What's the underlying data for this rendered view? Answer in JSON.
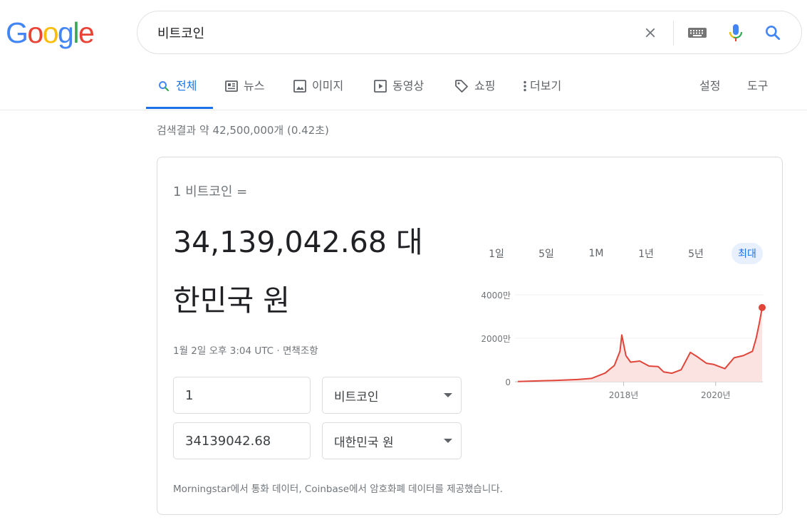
{
  "logo": {
    "letters": [
      "G",
      "o",
      "o",
      "g",
      "l",
      "e"
    ],
    "colors": [
      "#4285f4",
      "#ea4335",
      "#fbbc05",
      "#4285f4",
      "#34a853",
      "#ea4335"
    ]
  },
  "search": {
    "query": "비트코인",
    "icons": [
      "clear-icon",
      "keyboard-icon",
      "mic-icon",
      "search-icon"
    ]
  },
  "tabs": [
    {
      "label": "전체",
      "icon": "search-icon",
      "active": true
    },
    {
      "label": "뉴스",
      "icon": "news-icon"
    },
    {
      "label": "이미지",
      "icon": "image-icon"
    },
    {
      "label": "동영상",
      "icon": "video-icon"
    },
    {
      "label": "쇼핑",
      "icon": "tag-icon"
    },
    {
      "label": "더보기",
      "icon": "more-icon"
    }
  ],
  "tools": {
    "settings": "설정",
    "tools": "도구"
  },
  "result_stats": "검색결과 약 42,500,000개 (0.42초)",
  "converter": {
    "from_label": "1 비트코인 =",
    "value_line1": "34,139,042.68 대",
    "value_line2": "한민국 원",
    "datetime": "1월 2일 오후 3:04 UTC · 면책조항",
    "amount_input": "1",
    "amount_currency": "비트코인",
    "result_input": "34139042.68",
    "result_currency": "대한민국 원",
    "source_note": "Morningstar에서 통화 데이터, Coinbase에서 암호화폐 데이터를 제공했습니다."
  },
  "ranges": [
    "1일",
    "5일",
    "1M",
    "1년",
    "5년",
    "최대"
  ],
  "active_range": "최대",
  "colors": {
    "accent": "#1a73e8",
    "line": "#e0453a",
    "fill": "#fbe3e1"
  },
  "chart_data": {
    "type": "area",
    "y_tick_labels": [
      "4000만",
      "2000만",
      "0"
    ],
    "x_tick_labels": [
      "2018년",
      "2020년"
    ],
    "ylim": [
      0,
      40000000
    ],
    "series": [
      {
        "points": [
          [
            2015.7,
            80000
          ],
          [
            2016.0,
            300000
          ],
          [
            2016.5,
            600000
          ],
          [
            2017.0,
            1000000
          ],
          [
            2017.3,
            1500000
          ],
          [
            2017.6,
            4000000
          ],
          [
            2017.8,
            7500000
          ],
          [
            2017.92,
            14000000
          ],
          [
            2017.96,
            21500000
          ],
          [
            2018.05,
            12000000
          ],
          [
            2018.15,
            9000000
          ],
          [
            2018.35,
            9500000
          ],
          [
            2018.55,
            7200000
          ],
          [
            2018.75,
            7000000
          ],
          [
            2018.87,
            4500000
          ],
          [
            2019.05,
            3900000
          ],
          [
            2019.25,
            5500000
          ],
          [
            2019.45,
            13500000
          ],
          [
            2019.6,
            11500000
          ],
          [
            2019.8,
            8500000
          ],
          [
            2019.95,
            8000000
          ],
          [
            2020.2,
            6000000
          ],
          [
            2020.4,
            11000000
          ],
          [
            2020.6,
            12000000
          ],
          [
            2020.8,
            14000000
          ],
          [
            2020.88,
            20000000
          ],
          [
            2020.95,
            27000000
          ],
          [
            2021.01,
            34139042.68
          ]
        ]
      }
    ]
  }
}
